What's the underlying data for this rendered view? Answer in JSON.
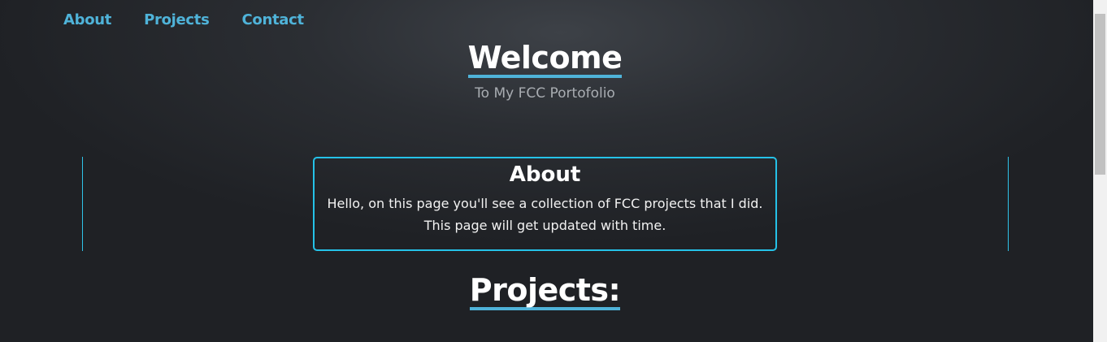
{
  "nav": {
    "items": [
      {
        "label": "About"
      },
      {
        "label": "Projects"
      },
      {
        "label": "Contact"
      }
    ]
  },
  "hero": {
    "title": "Welcome",
    "subtitle": "To My FCC Portofolio"
  },
  "about": {
    "heading": "About",
    "text": "Hello, on this page you'll see a collection of FCC projects that I did. This page will get updated with time."
  },
  "projects": {
    "heading": "Projects:"
  },
  "colors": {
    "accent": "#4fb3d9",
    "border": "#25c2e8",
    "background": "#2b2e33"
  }
}
